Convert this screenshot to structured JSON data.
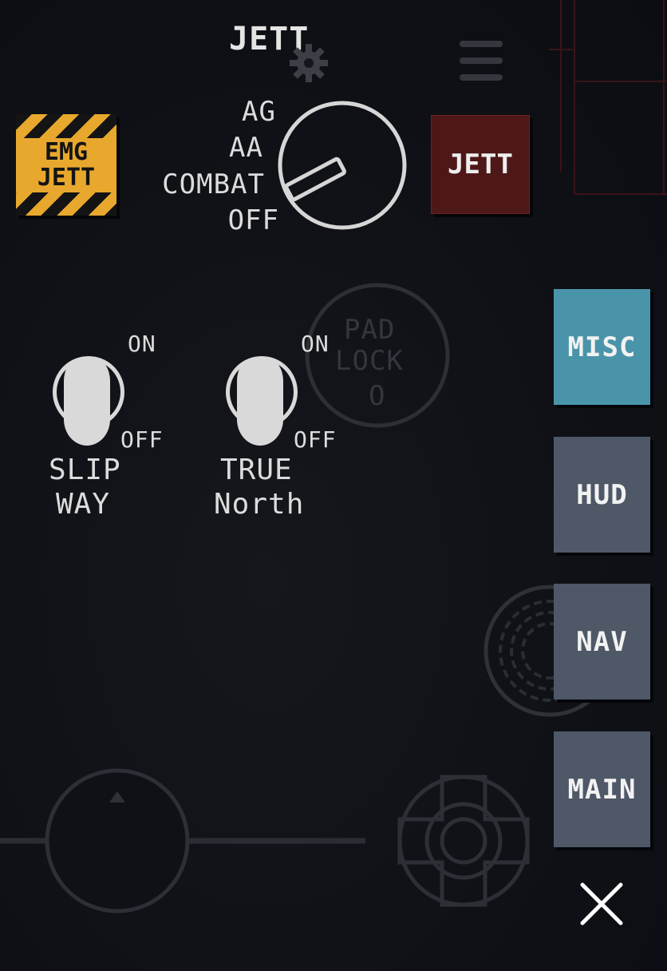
{
  "jettison_panel": {
    "title": "JETT",
    "emg_jett_line1": "EMG",
    "emg_jett_line2": "JETT",
    "jett_button_label": "JETT"
  },
  "selector": {
    "positions": [
      "AG",
      "AA",
      "COMBAT",
      "OFF"
    ],
    "current": "COMBAT"
  },
  "padlock": {
    "line1": "PAD",
    "line2": "LOCK",
    "line3": "O"
  },
  "toggles": [
    {
      "on_label": "ON",
      "off_label": "OFF",
      "name_line1": "SLIP",
      "name_line2": "WAY",
      "state": "off"
    },
    {
      "on_label": "ON",
      "off_label": "OFF",
      "name_line1": "TRUE",
      "name_line2": "North",
      "state": "off"
    }
  ],
  "side_menu": [
    {
      "label": "MISC",
      "active": true
    },
    {
      "label": "HUD",
      "active": false
    },
    {
      "label": "NAV",
      "active": false
    },
    {
      "label": "MAIN",
      "active": false
    }
  ],
  "colors": {
    "background": "#0f1116",
    "emg_yellow": "#e8a82d",
    "jett_red": "#4e1818",
    "menu_active": "#4a94aa",
    "menu_inactive": "#4e5866"
  },
  "icons": {
    "settings": "gear-icon",
    "menu": "hamburger-icon",
    "close": "close-icon"
  }
}
